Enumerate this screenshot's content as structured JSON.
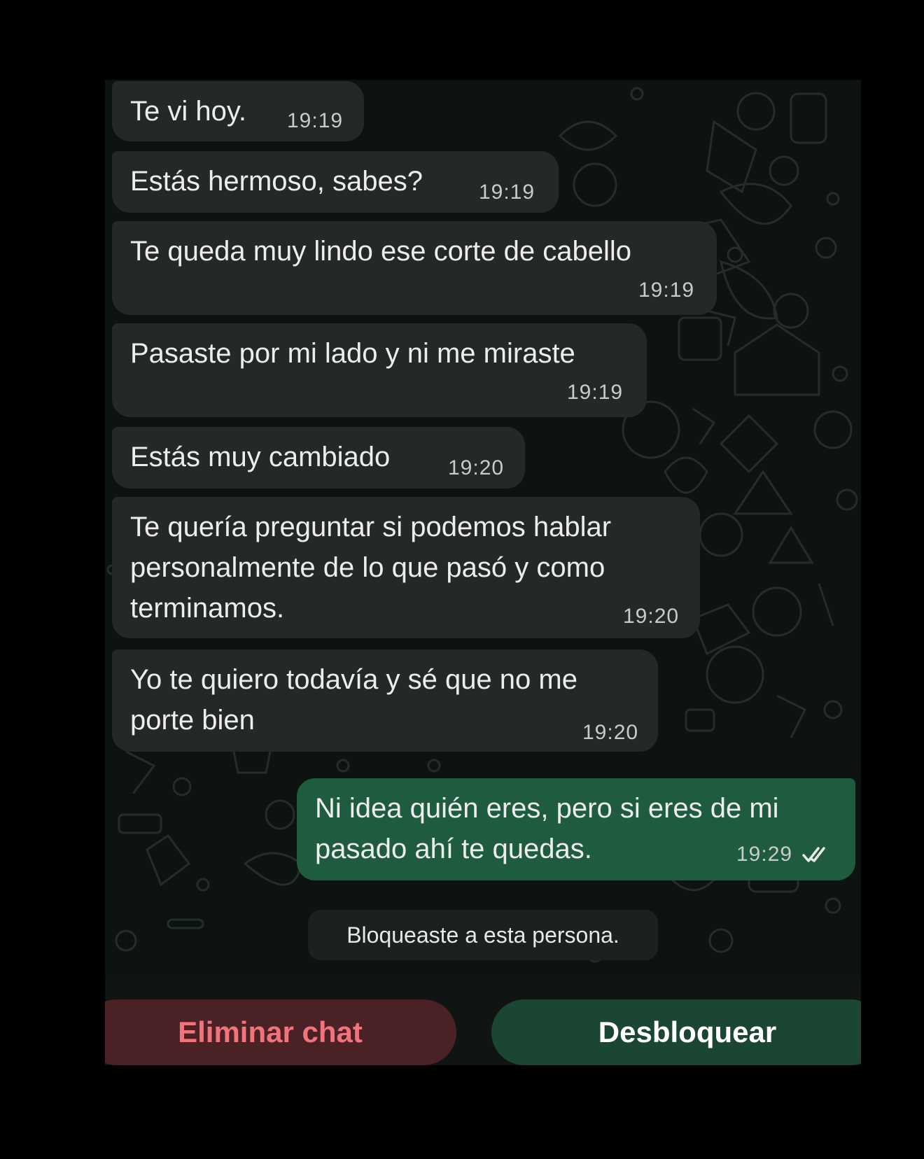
{
  "messages": [
    {
      "direction": "incoming",
      "text": "Te vi hoy.",
      "time": "19:19"
    },
    {
      "direction": "incoming",
      "text": "Estás hermoso, sabes?",
      "time": "19:19"
    },
    {
      "direction": "incoming",
      "text": "Te queda muy lindo ese corte de cabello",
      "time": "19:19"
    },
    {
      "direction": "incoming",
      "text": "Pasaste por mi lado y ni me miraste",
      "time": "19:19"
    },
    {
      "direction": "incoming",
      "text": "Estás muy cambiado",
      "time": "19:20"
    },
    {
      "direction": "incoming",
      "text": "Te quería preguntar si podemos hablar\npersonalmente de lo que pasó y como\nterminamos.",
      "time": "19:20"
    },
    {
      "direction": "incoming",
      "text": "Yo te quiero todavía y sé que no me\nporte bien",
      "time": "19:20"
    },
    {
      "direction": "outgoing",
      "text": "Ni idea quién eres, pero si eres de mi\npasado ahí te quedas.",
      "time": "19:29",
      "status": "read"
    }
  ],
  "system_note": "Bloqueaste a esta persona.",
  "actions": {
    "delete_label": "Eliminar chat",
    "unblock_label": "Desbloquear"
  },
  "colors": {
    "incoming_bubble": "#242826",
    "outgoing_bubble": "#1e5b3f",
    "delete_text": "#f1737b",
    "delete_bg": "#4a2226",
    "unblock_bg": "#1b4634"
  }
}
